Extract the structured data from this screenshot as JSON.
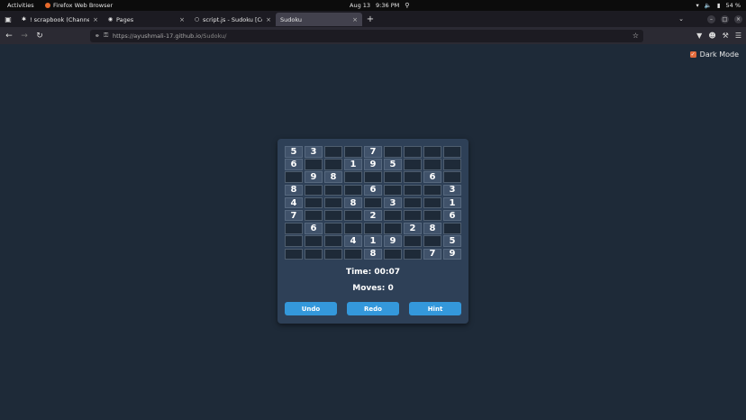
{
  "system_bar": {
    "activities": "Activities",
    "app_name": "Firefox Web Browser",
    "date": "Aug 13",
    "time": "9:36 PM",
    "battery": "54 %"
  },
  "tabs": [
    {
      "title": "! scrapbook (Channel) - H",
      "active": false
    },
    {
      "title": "Pages",
      "active": false
    },
    {
      "title": "script.js - Sudoku [Codesp",
      "active": false
    },
    {
      "title": "Sudoku",
      "active": true
    }
  ],
  "navbar": {
    "url_host": "https://ayushmali-17.github.io",
    "url_path": "/Sudoku/"
  },
  "page": {
    "dark_mode_label": "Dark Mode",
    "dark_mode_checked": true,
    "timer": "Time: 00:07",
    "moves": "Moves: 0",
    "buttons": {
      "undo": "Undo",
      "redo": "Redo",
      "hint": "Hint"
    },
    "board": [
      [
        "5",
        "3",
        "",
        "",
        "7",
        "",
        "",
        "",
        ""
      ],
      [
        "6",
        "",
        "",
        "1",
        "9",
        "5",
        "",
        "",
        ""
      ],
      [
        "",
        "9",
        "8",
        "",
        "",
        "",
        "",
        "6",
        ""
      ],
      [
        "8",
        "",
        "",
        "",
        "6",
        "",
        "",
        "",
        "3"
      ],
      [
        "4",
        "",
        "",
        "8",
        "",
        "3",
        "",
        "",
        "1"
      ],
      [
        "7",
        "",
        "",
        "",
        "2",
        "",
        "",
        "",
        "6"
      ],
      [
        "",
        "6",
        "",
        "",
        "",
        "",
        "2",
        "8",
        ""
      ],
      [
        "",
        "",
        "",
        "4",
        "1",
        "9",
        "",
        "",
        "5"
      ],
      [
        "",
        "",
        "",
        "",
        "8",
        "",
        "",
        "7",
        "9"
      ]
    ]
  }
}
